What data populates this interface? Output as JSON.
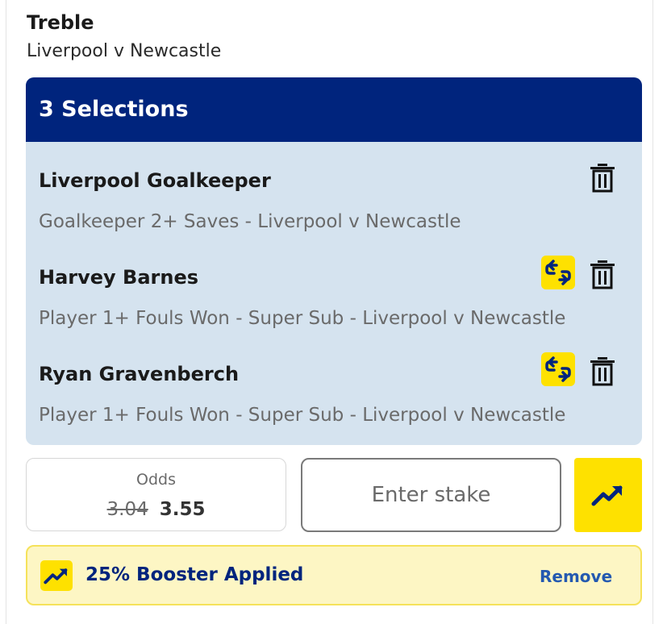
{
  "bet": {
    "type": "Treble",
    "event": "Liverpool v Newcastle"
  },
  "selections_header": "3 Selections",
  "selections": [
    {
      "name": "Liverpool Goalkeeper",
      "market": "Goalkeeper 2+ Saves - Liverpool v Newcastle",
      "swap_icon": false
    },
    {
      "name": "Harvey Barnes",
      "market": "Player 1+ Fouls Won - Super Sub - Liverpool v Newcastle",
      "swap_icon": true
    },
    {
      "name": "Ryan Gravenberch",
      "market": "Player 1+ Fouls Won - Super Sub - Liverpool v Newcastle",
      "swap_icon": true
    }
  ],
  "odds": {
    "label": "Odds",
    "original": "3.04",
    "boosted": "3.55"
  },
  "stake": {
    "placeholder": "Enter stake",
    "value": ""
  },
  "booster": {
    "text": "25% Booster Applied",
    "remove_label": "Remove"
  },
  "icons": {
    "trash": "trash-icon",
    "swap": "swap-icon",
    "boost": "trending-up-icon"
  },
  "colors": {
    "header_navy": "#00247d",
    "selection_bg": "#d5e3ef",
    "accent_yellow": "#fee100",
    "banner_bg": "#fdf6c4",
    "link_blue": "#2459b0"
  }
}
